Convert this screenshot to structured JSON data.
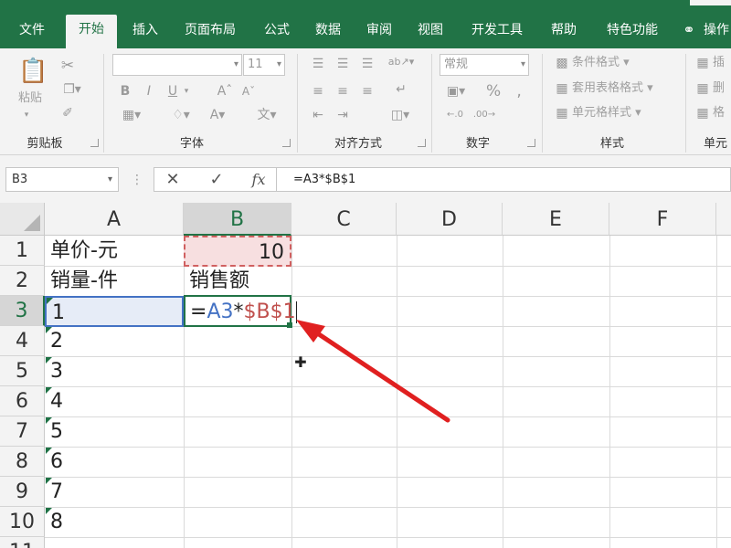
{
  "ribbon_tabs": [
    {
      "label": "文件"
    },
    {
      "label": "开始"
    },
    {
      "label": "插入"
    },
    {
      "label": "页面布局"
    },
    {
      "label": "公式"
    },
    {
      "label": "数据"
    },
    {
      "label": "审阅"
    },
    {
      "label": "视图"
    },
    {
      "label": "开发工具"
    },
    {
      "label": "帮助"
    },
    {
      "label": "特色功能"
    },
    {
      "label": "操作"
    }
  ],
  "ribbon": {
    "clipboard": {
      "paste": "粘贴",
      "label": "剪贴板"
    },
    "font": {
      "size": "11",
      "label": "字体",
      "bold": "B",
      "italic": "I",
      "underline": "U",
      "font_color": "A",
      "wen": "文"
    },
    "alignment": {
      "label": "对齐方式"
    },
    "number": {
      "format": "常规",
      "percent": "%",
      "label": "数字"
    },
    "styles": {
      "conditional": "条件格式",
      "table": "套用表格格式",
      "cell": "单元格样式",
      "label": "样式"
    },
    "cells": {
      "insert": "插",
      "delete": "删",
      "format": "格",
      "label": "单元"
    }
  },
  "formula_bar": {
    "name_box": "B3",
    "cancel": "✕",
    "enter": "✓",
    "fx": "fx",
    "formula": "=A3*$B$1"
  },
  "columns": [
    "A",
    "B",
    "C",
    "D",
    "E",
    "F"
  ],
  "rows": [
    "1",
    "2",
    "3",
    "4",
    "5",
    "6",
    "7",
    "8",
    "9",
    "10",
    "11"
  ],
  "cells": {
    "A1": "单价-元",
    "B1": "10",
    "A2": "销量-件",
    "B2": "销售额",
    "A3": "1",
    "A4": "2",
    "A5": "3",
    "A6": "4",
    "A7": "5",
    "A8": "6",
    "A9": "7",
    "A10": "8"
  },
  "b3_formula": {
    "eq": "=",
    "ref1": "A3",
    "op": "*",
    "ref2": "$B$1"
  },
  "colors": {
    "accent": "#217346",
    "ref_blue": "#4472c4",
    "ref_red": "#c0504d",
    "arrow": "#e02020"
  }
}
